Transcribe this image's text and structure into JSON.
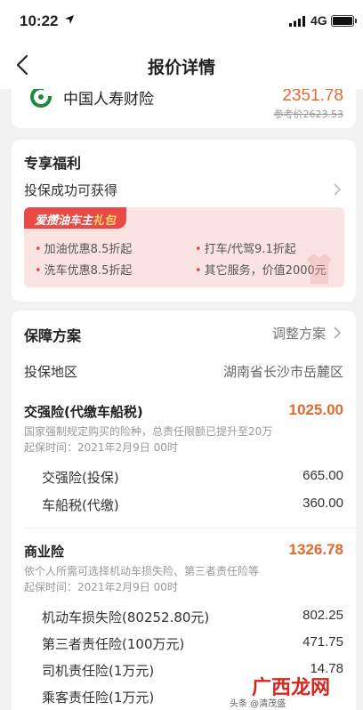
{
  "status_bar": {
    "time": "10:22",
    "network": "4G"
  },
  "nav": {
    "title": "报价详情"
  },
  "insurer": {
    "name": "中国人寿财险",
    "price": "2351.78",
    "ref_price": "参考价2623.53"
  },
  "benefits": {
    "title": "专享福利",
    "subtitle": "投保成功可获得",
    "tag_main": "爱攒油车主",
    "tag_highlight": "礼包",
    "items": [
      "加油优惠8.5折起",
      "打车/代驾9.1折起",
      "洗车优惠8.5折起",
      "其它服务，价值2000元"
    ]
  },
  "plan": {
    "title": "保障方案",
    "adjust_label": "调整方案",
    "region_label": "投保地区",
    "region_value": "湖南省长沙市岳麓区",
    "compulsory": {
      "title": "交强险(代缴车船税)",
      "amount": "1025.00",
      "desc": "国家强制规定购买的险种，总责任限额已提升至20万",
      "start": "起保时间：2021年2月9日 00时",
      "items": [
        {
          "label": "交强险(投保)",
          "value": "665.00"
        },
        {
          "label": "车船税(代缴)",
          "value": "360.00"
        }
      ]
    },
    "commercial": {
      "title": "商业险",
      "amount": "1326.78",
      "desc": "依个人所需可选择机动车损失险、第三者责任险等",
      "start": "起保时间：2021年2月9日 00时",
      "items": [
        {
          "label": "机动车损失险(80252.80元)",
          "value": "802.25"
        },
        {
          "label": "第三者责任险(100万元)",
          "value": "471.75"
        },
        {
          "label": "司机责任险(1万元)",
          "value": "14.78"
        },
        {
          "label": "乘客责任险(1万元)",
          "value": ""
        }
      ]
    }
  },
  "watermark": {
    "main": "广西龙网",
    "sub": "头条 @清茂盛"
  }
}
